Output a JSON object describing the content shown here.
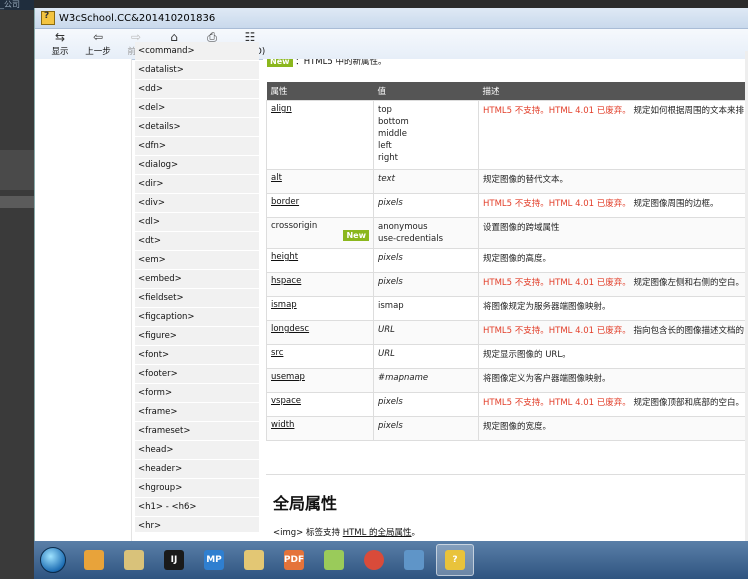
{
  "background": {
    "crumb": "_公司"
  },
  "window": {
    "title": "W3cSchool.CC&201410201836"
  },
  "toolbar": {
    "buttons": [
      {
        "label": "显示",
        "icon": "show-hide-icon",
        "enabled": true
      },
      {
        "label": "上一步",
        "icon": "back-arrow-icon",
        "enabled": true
      },
      {
        "label": "前进",
        "icon": "forward-arrow-icon",
        "enabled": false
      },
      {
        "label": "主页",
        "icon": "home-icon",
        "enabled": true
      },
      {
        "label": "打印",
        "icon": "print-icon",
        "enabled": true
      },
      {
        "label": "选项(O)",
        "icon": "options-icon",
        "enabled": true
      }
    ]
  },
  "nav": {
    "items": [
      "<command>",
      "<datalist>",
      "<dd>",
      "<del>",
      "<details>",
      "<dfn>",
      "<dialog>",
      "<dir>",
      "<div>",
      "<dl>",
      "<dt>",
      "<em>",
      "<embed>",
      "<fieldset>",
      "<figcaption>",
      "<figure>",
      "<font>",
      "<footer>",
      "<form>",
      "<frame>",
      "<frameset>",
      "<head>",
      "<header>",
      "<hgroup>",
      "<h1> - <h6>",
      "<hr>"
    ]
  },
  "content": {
    "new_badge": "New",
    "new_note": "：HTML5 中的新属性。",
    "table": {
      "headers": [
        "属性",
        "值",
        "描述"
      ],
      "rows": [
        {
          "attr": "align",
          "link": true,
          "values": [
            "top",
            "bottom",
            "middle",
            "left",
            "right"
          ],
          "italic": false,
          "deprecated": "HTML5 不支持。HTML 4.01 已废弃。",
          "desc": "规定如何根据周围的文本来排"
        },
        {
          "attr": "alt",
          "link": true,
          "values": [
            "text"
          ],
          "italic": true,
          "deprecated": "",
          "desc": "规定图像的替代文本。"
        },
        {
          "attr": "border",
          "link": true,
          "values": [
            "pixels"
          ],
          "italic": true,
          "deprecated": "HTML5 不支持。HTML 4.01 已废弃。",
          "desc": "规定图像周围的边框。"
        },
        {
          "attr": "crossorigin",
          "link": false,
          "new": true,
          "values": [
            "anonymous",
            "use-credentials"
          ],
          "italic": false,
          "deprecated": "",
          "desc": "设置图像的跨域属性"
        },
        {
          "attr": "height",
          "link": true,
          "values": [
            "pixels"
          ],
          "italic": true,
          "deprecated": "",
          "desc": "规定图像的高度。"
        },
        {
          "attr": "hspace",
          "link": true,
          "values": [
            "pixels"
          ],
          "italic": true,
          "deprecated": "HTML5 不支持。HTML 4.01 已废弃。",
          "desc": "规定图像左侧和右侧的空白。"
        },
        {
          "attr": "ismap",
          "link": true,
          "values": [
            "ismap"
          ],
          "italic": false,
          "deprecated": "",
          "desc": "将图像规定为服务器端图像映射。"
        },
        {
          "attr": "longdesc",
          "link": true,
          "values": [
            "URL"
          ],
          "italic": true,
          "deprecated": "HTML5 不支持。HTML 4.01 已废弃。",
          "desc": "指向包含长的图像描述文档的"
        },
        {
          "attr": "src",
          "link": true,
          "values": [
            "URL"
          ],
          "italic": true,
          "deprecated": "",
          "desc": "规定显示图像的 URL。"
        },
        {
          "attr": "usemap",
          "link": true,
          "values": [
            "#mapname"
          ],
          "italic": true,
          "deprecated": "",
          "desc": "将图像定义为客户器端图像映射。"
        },
        {
          "attr": "vspace",
          "link": true,
          "values": [
            "pixels"
          ],
          "italic": true,
          "deprecated": "HTML5 不支持。HTML 4.01 已废弃。",
          "desc": "规定图像顶部和底部的空白。"
        },
        {
          "attr": "width",
          "link": true,
          "values": [
            "pixels"
          ],
          "italic": true,
          "deprecated": "",
          "desc": "规定图像的宽度。"
        }
      ]
    },
    "global_heading": "全局属性",
    "global_desc_pre": "<img> 标签支持 ",
    "global_desc_link": "HTML 的全局属性",
    "global_desc_post": "。"
  },
  "taskbar": {
    "apps": [
      {
        "name": "start-button",
        "label": ""
      },
      {
        "name": "taskbar-app-colors",
        "label": "",
        "color": "#e8a33a"
      },
      {
        "name": "taskbar-app-paint",
        "label": "",
        "color": "#d9c27a"
      },
      {
        "name": "taskbar-app-intellij",
        "label": "IJ",
        "color": "#1a1a1a"
      },
      {
        "name": "taskbar-app-mp",
        "label": "MP",
        "color": "#2f7fd0"
      },
      {
        "name": "taskbar-app-explorer",
        "label": "",
        "color": "#e3c774"
      },
      {
        "name": "taskbar-app-pdf",
        "label": "PDF",
        "color": "#e5733a"
      },
      {
        "name": "taskbar-app-notepad",
        "label": "",
        "color": "#9acb5a"
      },
      {
        "name": "taskbar-app-chrome",
        "label": "",
        "color": "#d94b3a"
      },
      {
        "name": "taskbar-app-photos",
        "label": "",
        "color": "#5f95c8"
      },
      {
        "name": "taskbar-app-help",
        "label": "?",
        "color": "#e9c33b"
      }
    ]
  }
}
